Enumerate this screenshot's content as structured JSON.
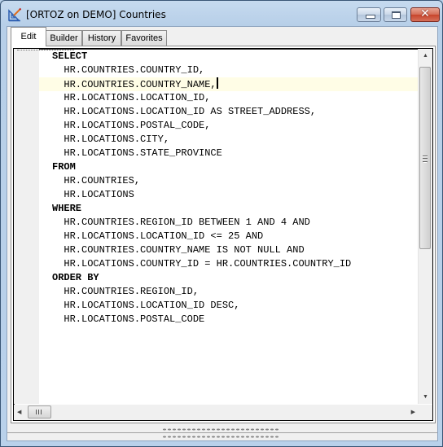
{
  "window": {
    "title": "[ORTOZ on DEMO] Countries",
    "app_icon": "query-builder-icon",
    "controls": {
      "minimize": "minimize-icon",
      "maximize": "maximize-icon",
      "close": "close-icon",
      "close_glyph": "✕"
    }
  },
  "tabs": [
    {
      "label": "Edit",
      "active": true
    },
    {
      "label": "Builder",
      "active": false
    },
    {
      "label": "History",
      "active": false
    },
    {
      "label": "Favorites",
      "active": false
    }
  ],
  "editor": {
    "current_line": 2,
    "lines": [
      {
        "text": "SELECT",
        "keyword": true
      },
      {
        "text": "  HR.COUNTRIES.COUNTRY_ID,",
        "keyword": false
      },
      {
        "text": "  HR.COUNTRIES.COUNTRY_NAME,",
        "keyword": false
      },
      {
        "text": "  HR.LOCATIONS.LOCATION_ID,",
        "keyword": false
      },
      {
        "text": "  HR.LOCATIONS.LOCATION_ID AS STREET_ADDRESS,",
        "keyword": false
      },
      {
        "text": "  HR.LOCATIONS.POSTAL_CODE,",
        "keyword": false
      },
      {
        "text": "  HR.LOCATIONS.CITY,",
        "keyword": false
      },
      {
        "text": "  HR.LOCATIONS.STATE_PROVINCE",
        "keyword": false
      },
      {
        "text": "FROM",
        "keyword": true
      },
      {
        "text": "  HR.COUNTRIES,",
        "keyword": false
      },
      {
        "text": "  HR.LOCATIONS",
        "keyword": false
      },
      {
        "text": "WHERE",
        "keyword": true
      },
      {
        "text": "  HR.COUNTRIES.REGION_ID BETWEEN 1 AND 4 AND",
        "keyword": false
      },
      {
        "text": "  HR.LOCATIONS.LOCATION_ID <= 25 AND",
        "keyword": false
      },
      {
        "text": "  HR.COUNTRIES.COUNTRY_NAME IS NOT NULL AND",
        "keyword": false
      },
      {
        "text": "  HR.LOCATIONS.COUNTRY_ID = HR.COUNTRIES.COUNTRY_ID",
        "keyword": false
      },
      {
        "text": "ORDER BY",
        "keyword": true
      },
      {
        "text": "  HR.COUNTRIES.REGION_ID,",
        "keyword": false
      },
      {
        "text": "  HR.LOCATIONS.LOCATION_ID DESC,",
        "keyword": false
      },
      {
        "text": "  HR.LOCATIONS.POSTAL_CODE",
        "keyword": false
      }
    ],
    "scroll_up_glyph": "▲",
    "scroll_down_glyph": "▼",
    "scroll_left_glyph": "◀",
    "scroll_right_glyph": "▶"
  }
}
